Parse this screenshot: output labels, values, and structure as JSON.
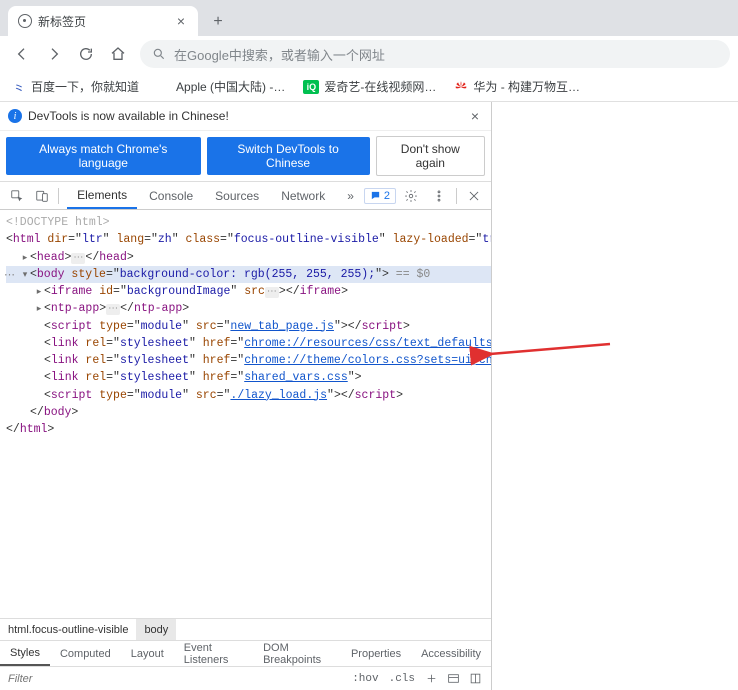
{
  "tab": {
    "title": "新标签页"
  },
  "omnibox": {
    "placeholder": "在Google中搜索，或者输入一个网址"
  },
  "bookmarks": {
    "b0": "百度一下，你就知道",
    "b1": "Apple (中国大陆) -…",
    "b2": "爱奇艺-在线视频网…",
    "b3": "华为 - 构建万物互…"
  },
  "infobar": {
    "text": "DevTools is now available in Chinese!"
  },
  "actions": {
    "match": "Always match Chrome's language",
    "switch": "Switch DevTools to Chinese",
    "dont": "Don't show again"
  },
  "dt_tabs": {
    "elements": "Elements",
    "console": "Console",
    "sources": "Sources",
    "network": "Network"
  },
  "issues": {
    "count": "2"
  },
  "tree": {
    "doctype": "<!DOCTYPE html>",
    "html_open": {
      "tag": "html",
      "dir": "ltr",
      "lang": "zh",
      "cls": "focus-outline-visible",
      "lazy": "true"
    },
    "head": "head",
    "body_style": "background-color: rgb(255, 255, 255);",
    "eq0": " == $0",
    "iframe_id": "backgroundImage",
    "ntp": "ntp-app",
    "scr1_src": "new_tab_page.js",
    "link1_href": "chrome://resources/css/text_defaults_md.css",
    "link2_href": "chrome://theme/colors.css?sets=ui,chrome",
    "link3_href": "shared_vars.css",
    "scr2_src": "./lazy_load.js",
    "module": "module",
    "stylesheet": "stylesheet"
  },
  "crumbs": {
    "html": "html.focus-outline-visible",
    "body": "body"
  },
  "styles_tabs": {
    "styles": "Styles",
    "computed": "Computed",
    "layout": "Layout",
    "listeners": "Event Listeners",
    "dom": "DOM Breakpoints",
    "props": "Properties",
    "acc": "Accessibility"
  },
  "filter": {
    "placeholder": "Filter",
    "hov": ":hov",
    "cls": ".cls"
  }
}
